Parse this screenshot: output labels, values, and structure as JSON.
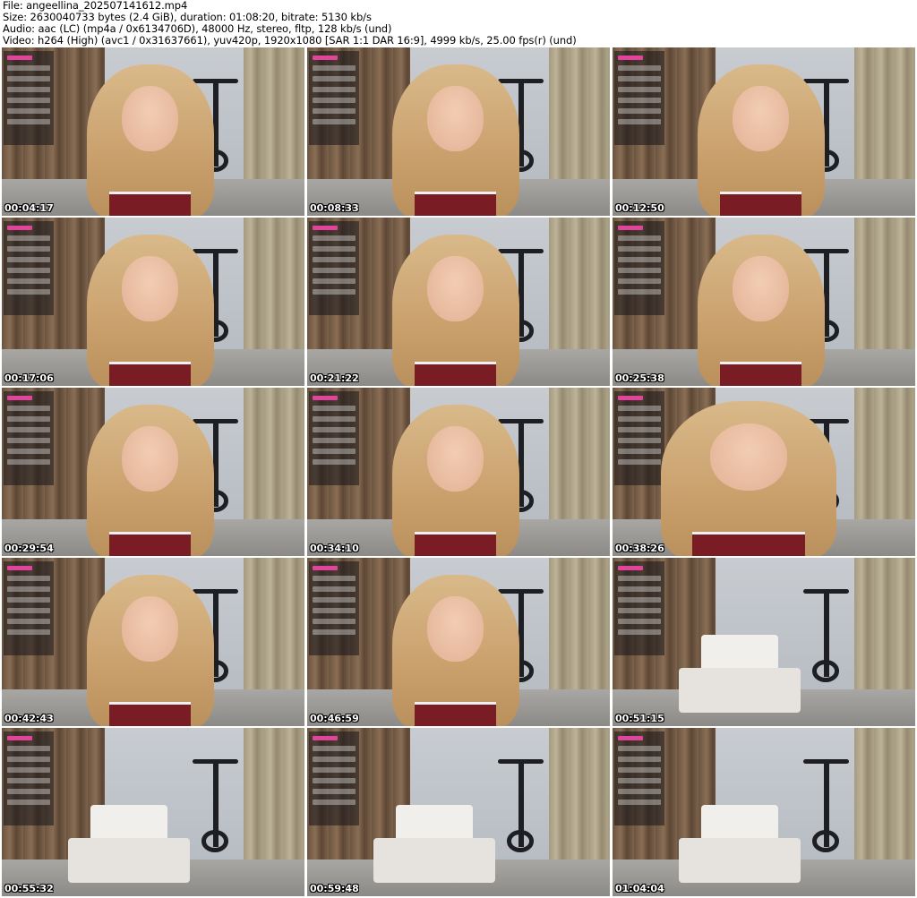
{
  "header": {
    "file": "File: angeellina_202507141612.mp4",
    "size": "Size: 2630040733 bytes (2.4 GiB), duration: 01:08:20, bitrate: 5130 kb/s",
    "audio": "Audio: aac (LC) (mp4a / 0x6134706D), 48000 Hz, stereo, fltp, 128 kb/s (und)",
    "video": "Video: h264 (High) (avc1 / 0x31637661), yuv420p, 1920x1080 [SAR 1:1 DAR 16:9], 4999 kb/s, 25.00 fps(r) (und)"
  },
  "thumbnails": [
    {
      "timestamp": "00:04:17",
      "scene": "person"
    },
    {
      "timestamp": "00:08:33",
      "scene": "person"
    },
    {
      "timestamp": "00:12:50",
      "scene": "person"
    },
    {
      "timestamp": "00:17:06",
      "scene": "person"
    },
    {
      "timestamp": "00:21:22",
      "scene": "person"
    },
    {
      "timestamp": "00:25:38",
      "scene": "person"
    },
    {
      "timestamp": "00:29:54",
      "scene": "person"
    },
    {
      "timestamp": "00:34:10",
      "scene": "person"
    },
    {
      "timestamp": "00:38:26",
      "scene": "person-close"
    },
    {
      "timestamp": "00:42:43",
      "scene": "person"
    },
    {
      "timestamp": "00:46:59",
      "scene": "person"
    },
    {
      "timestamp": "00:51:15",
      "scene": "empty-room"
    },
    {
      "timestamp": "00:55:32",
      "scene": "empty-room"
    },
    {
      "timestamp": "00:59:48",
      "scene": "empty-room"
    },
    {
      "timestamp": "01:04:04",
      "scene": "empty-room"
    }
  ]
}
